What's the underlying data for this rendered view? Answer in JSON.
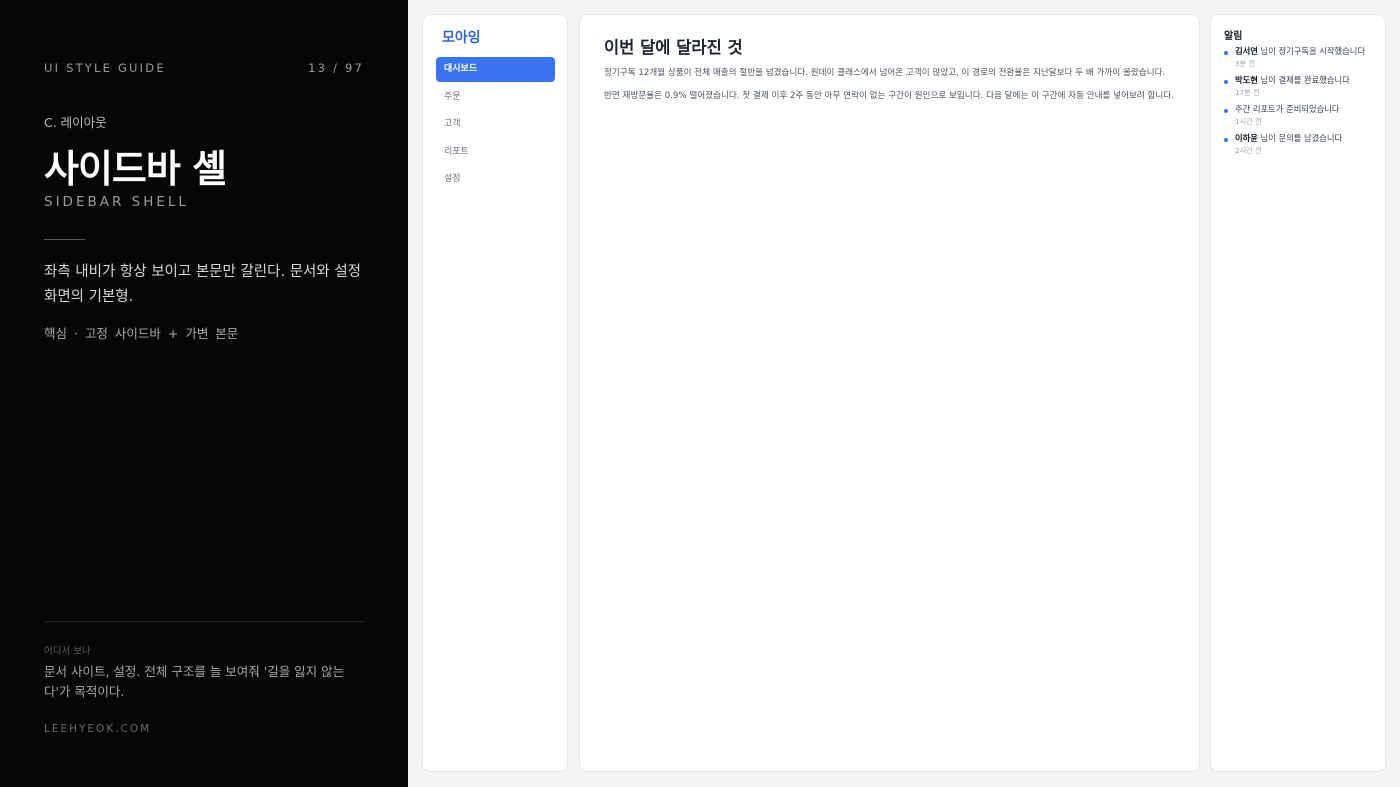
{
  "guide": {
    "header_left": "UI STYLE GUIDE",
    "page_counter": "13 / 97",
    "section_label": "C. 레이아웃",
    "title": "사이드바 셸",
    "subtitle": "SIDEBAR SHELL",
    "description": "좌측 내비가 항상 보이고 본문만 갈린다. 문서와 설정 화면의 기본형.",
    "key_point": "핵심 · 고정 사이드바 + 가변 본문",
    "where_label": "어디서 보나",
    "where_text": "문서 사이트, 설정. 전체 구조를 늘 보여줘 '길을 잃지 않는다'가 목적이다.",
    "site": "LEEHYEOK.COM"
  },
  "app": {
    "brand": "모아잉",
    "nav_items": [
      {
        "label": "대시보드",
        "active": true
      },
      {
        "label": "주문",
        "active": false
      },
      {
        "label": "고객",
        "active": false
      },
      {
        "label": "리포트",
        "active": false
      },
      {
        "label": "설정",
        "active": false
      }
    ],
    "main": {
      "title": "이번 달에 달라진 것",
      "paragraphs": [
        "정기구독 12개월 상품이 전체 매출의 절반을 넘겼습니다. 원데이 클래스에서 넘어온 고객이 많았고, 이 경로의 전환율은 지난달보다 두 배 가까이 올랐습니다.",
        "반면 재방문율은 0.9% 떨어졌습니다. 첫 결제 이후 2주 동안 아무 연락이 없는 구간이 원인으로 보입니다. 다음 달에는 이 구간에 자동 안내를 넣어보려 합니다."
      ]
    },
    "notifications": {
      "title": "알림",
      "items": [
        {
          "name": "김서연",
          "text": " 님이 정기구독을 시작했습니다",
          "time": "3분 전"
        },
        {
          "name": "박도현",
          "text": " 님이 결제를 완료했습니다",
          "time": "17분 전"
        },
        {
          "name": "",
          "text": "주간 리포트가 준비되었습니다",
          "time": "1시간 전"
        },
        {
          "name": "이하윤",
          "text": " 님이 문의를 남겼습니다",
          "time": "2시간 전"
        }
      ]
    },
    "colors": {
      "accent": "#3b74f2",
      "brand": "#2f64d6",
      "guide_bg": "#070708"
    }
  }
}
